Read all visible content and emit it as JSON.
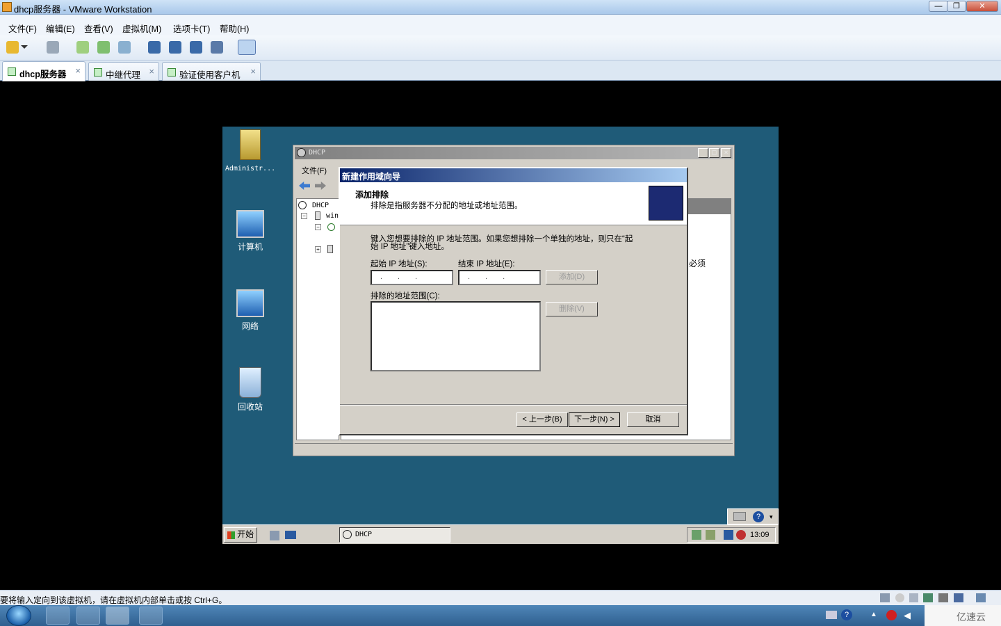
{
  "window": {
    "title": "dhcp服务器 - VMware Workstation",
    "min": "—",
    "max": "❐",
    "close": "✕"
  },
  "menu": [
    "文件(F)",
    "编辑(E)",
    "查看(V)",
    "虚拟机(M)",
    "选项卡(T)",
    "帮助(H)"
  ],
  "tabs": [
    {
      "label": "dhcp服务器",
      "close": "×"
    },
    {
      "label": "中继代理",
      "close": "×"
    },
    {
      "label": "验证使用客户机",
      "close": "×"
    }
  ],
  "desktop_icons": [
    "Administr...",
    "计算机",
    "网络",
    "回收站"
  ],
  "mmc": {
    "title": "DHCP",
    "menu": [
      "文件(F)"
    ],
    "tree": {
      "root": "DHCP",
      "node": "win"
    },
    "right_text": "必须"
  },
  "wizard": {
    "title": "新建作用域向导",
    "heading": "添加排除",
    "subheading": "排除是指服务器不分配的地址或地址范围。",
    "desc_line1": "键入您想要排除的 IP 地址范围。如果您想排除一个单独的地址，则只在“起",
    "desc_line2": "始 IP 地址”键入地址。",
    "start_label": "起始 IP 地址(S):",
    "end_label": "结束 IP 地址(E):",
    "ip_dots": "...",
    "add_button": "添加(D)",
    "excluded_label": "排除的地址范围(C):",
    "remove_button": "删除(V)",
    "back_button": "< 上一步(B)",
    "next_button": "下一步(N) >",
    "cancel_button": "取消"
  },
  "guest_taskbar": {
    "start": "开始",
    "task": "DHCP",
    "time": "13:09"
  },
  "status_text": "要将输入定向到该虚拟机，请在虚拟机内部单击或按 Ctrl+G。",
  "watermark": "亿速云",
  "colors": {
    "guest_desktop": "#1f5b78",
    "wizard_title": "#0a246a",
    "host_taskbar": "#3b6fa0"
  }
}
